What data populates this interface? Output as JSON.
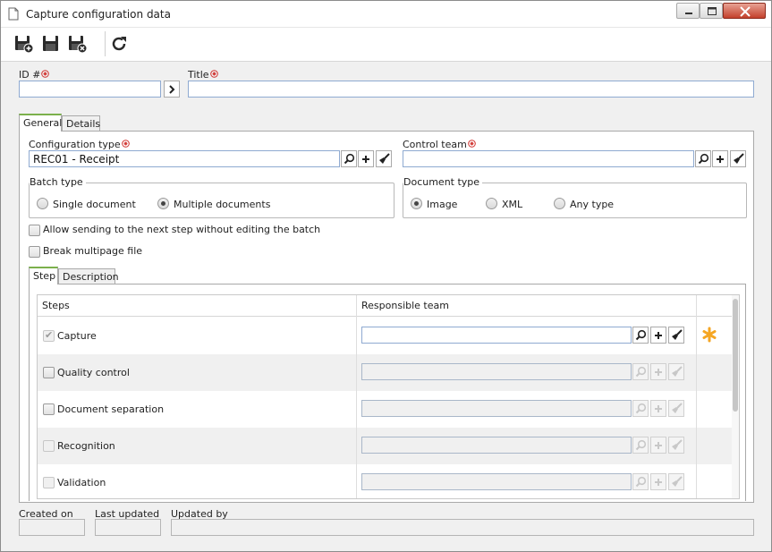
{
  "window": {
    "title": "Capture configuration data"
  },
  "toolbar": {
    "save_new_icon": "save-new-icon",
    "save_icon": "save-icon",
    "save_close_icon": "save-close-icon",
    "refresh_icon": "refresh-icon"
  },
  "header_fields": {
    "id_label": "ID #",
    "id_value": "",
    "title_label": "Title",
    "title_value": ""
  },
  "tabs": [
    {
      "label": "General",
      "active": true
    },
    {
      "label": "Details",
      "active": false
    }
  ],
  "general": {
    "configuration_type_label": "Configuration type",
    "configuration_type_value": "REC01 - Receipt",
    "control_team_label": "Control team",
    "control_team_value": "",
    "batch_type": {
      "title": "Batch type",
      "options": [
        {
          "label": "Single document",
          "selected": false
        },
        {
          "label": "Multiple documents",
          "selected": true
        }
      ]
    },
    "document_type": {
      "title": "Document type",
      "options": [
        {
          "label": "Image",
          "selected": true
        },
        {
          "label": "XML",
          "selected": false
        },
        {
          "label": "Any type",
          "selected": false
        }
      ]
    },
    "allow_sending_label": "Allow sending to the next step without editing the batch",
    "allow_sending_checked": false,
    "break_multipage_label": "Break multipage file",
    "break_multipage_checked": false
  },
  "sub_tabs": [
    {
      "label": "Step",
      "active": true
    },
    {
      "label": "Description",
      "active": false
    }
  ],
  "steps_table": {
    "columns": [
      "Steps",
      "Responsible team"
    ],
    "rows": [
      {
        "step": "Capture",
        "checked": true,
        "enabled": false,
        "team": "",
        "team_enabled": true
      },
      {
        "step": "Quality control",
        "checked": false,
        "enabled": true,
        "team": "",
        "team_enabled": false
      },
      {
        "step": "Document separation",
        "checked": false,
        "enabled": true,
        "team": "",
        "team_enabled": false
      },
      {
        "step": "Recognition",
        "checked": false,
        "enabled": false,
        "team": "",
        "team_enabled": false
      },
      {
        "step": "Validation",
        "checked": false,
        "enabled": false,
        "team": "",
        "team_enabled": false
      }
    ],
    "required_marker_icon": "asterisk-icon"
  },
  "footer": {
    "created_on_label": "Created on",
    "created_on_value": "",
    "last_updated_label": "Last updated",
    "last_updated_value": "",
    "updated_by_label": "Updated by",
    "updated_by_value": ""
  },
  "colors": {
    "required": "#d0312d",
    "tab_accent": "#7bb04c",
    "input_border": "#8faad1",
    "asterisk": "#f5a623"
  }
}
